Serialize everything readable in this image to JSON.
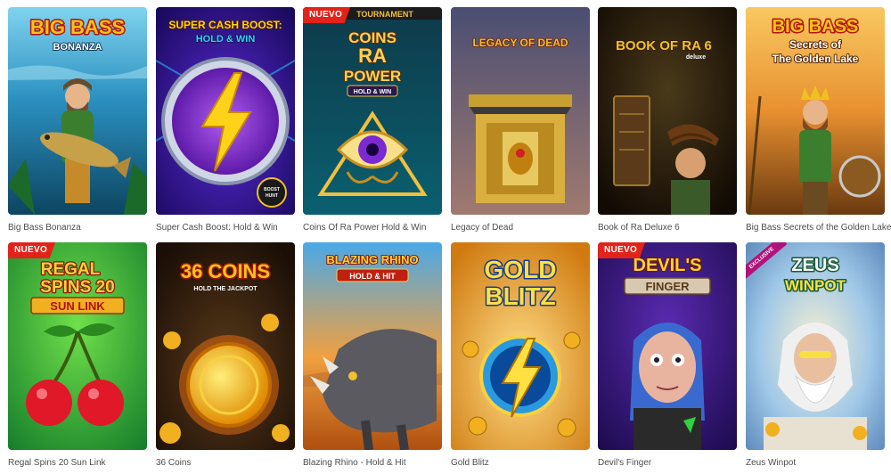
{
  "games": [
    {
      "title": "Big Bass Bonanza",
      "art": [
        "BIG BASS",
        "BONANZA"
      ]
    },
    {
      "title": "Super Cash Boost: Hold & Win",
      "art": [
        "SUPER CASH BOOST:",
        "HOLD & WIN"
      ]
    },
    {
      "title": "Coins Of Ra Power Hold & Win",
      "art": [
        "TOURNAMENT",
        "COINS",
        "RA",
        "POWER",
        "HOLD & WIN"
      ],
      "badge": "NUEVO"
    },
    {
      "title": "Legacy of Dead",
      "art": [
        "LEGACY OF DEAD"
      ]
    },
    {
      "title": "Book of Ra Deluxe 6",
      "art": [
        "BOOK OF RA 6",
        "deluxe"
      ]
    },
    {
      "title": "Big Bass Secrets of the Golden Lake",
      "art": [
        "BIG BASS",
        "Secrets of",
        "The Golden Lake"
      ]
    },
    {
      "title": "Regal Spins 20 Sun Link",
      "art": [
        "REGAL",
        "SPINS 20",
        "SUN LINK"
      ],
      "badge": "NUEVO"
    },
    {
      "title": "36 Coins",
      "art": [
        "36 COINS",
        "HOLD THE JACKPOT"
      ]
    },
    {
      "title": "Blazing Rhino - Hold & Hit",
      "art": [
        "BLAZING RHINO",
        "HOLD & HIT"
      ]
    },
    {
      "title": "Gold Blitz",
      "art": [
        "GOLD",
        "BLITZ"
      ]
    },
    {
      "title": "Devil's Finger",
      "art": [
        "DEVIL'S",
        "FINGER"
      ],
      "badge": "NUEVO"
    },
    {
      "title": "Zeus Winpot",
      "art": [
        "ZEUS",
        "WINPOT"
      ],
      "badge": "EXCLUSIVE"
    }
  ],
  "colors": {
    "caption": "#4d4d4d",
    "badge_new": "#e2231a",
    "badge_exclusive": "#b0127a"
  }
}
